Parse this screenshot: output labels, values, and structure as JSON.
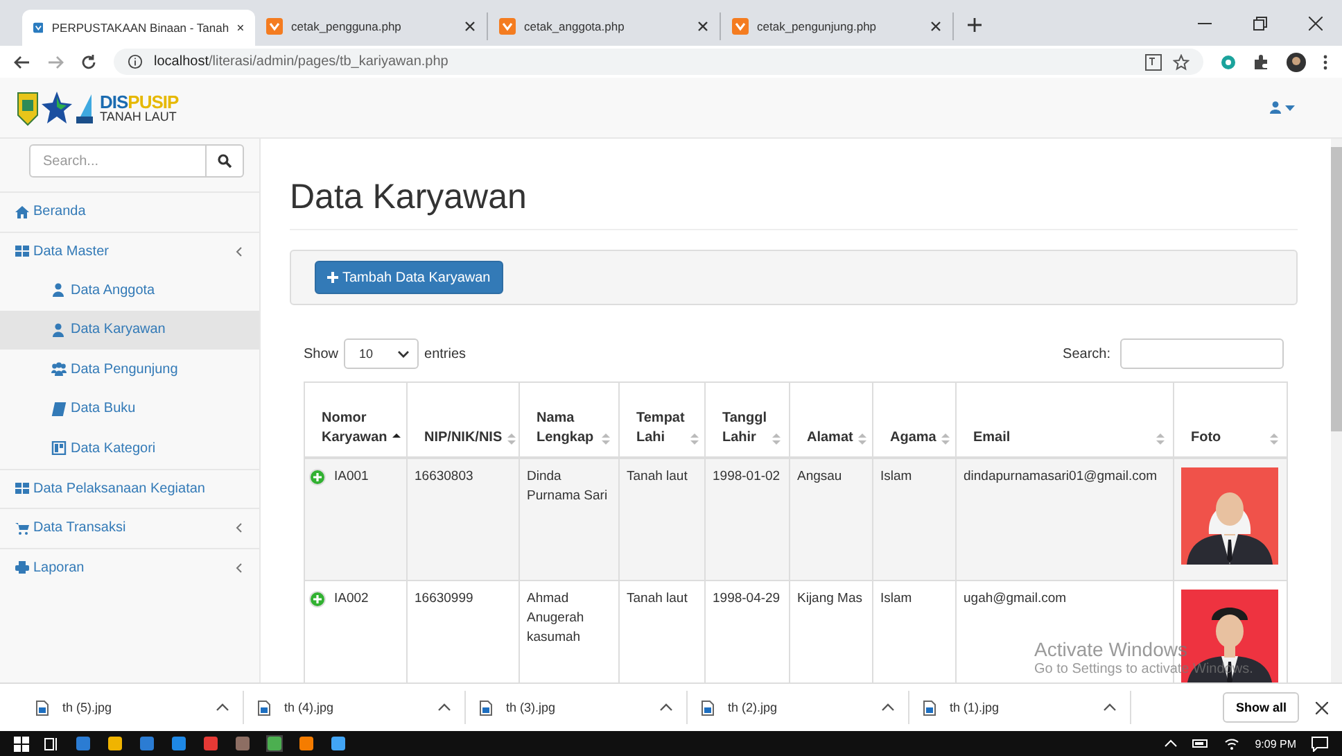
{
  "browser": {
    "tabs": [
      {
        "title": "PERPUSTAKAAN Binaan - Tanah",
        "selected": true
      },
      {
        "title": "cetak_pengguna.php",
        "selected": false
      },
      {
        "title": "cetak_anggota.php",
        "selected": false
      },
      {
        "title": "cetak_pengunjung.php",
        "selected": false
      }
    ],
    "url_host": "localhost",
    "url_path": "/literasi/admin/pages/tb_kariyawan.php"
  },
  "brand": {
    "line1_a": "DIS",
    "line1_b": "PUSIP",
    "line2": "TANAH LAUT"
  },
  "sidebar": {
    "search_placeholder": "Search...",
    "items": [
      {
        "label": "Beranda",
        "selected": false,
        "collapsible": false
      },
      {
        "label": "Data Master",
        "selected": false,
        "collapsible": true,
        "children": [
          {
            "label": "Data Anggota",
            "selected": false
          },
          {
            "label": "Data Karyawan",
            "selected": true
          },
          {
            "label": "Data Pengunjung",
            "selected": false
          },
          {
            "label": "Data Buku",
            "selected": false
          },
          {
            "label": "Data Kategori",
            "selected": false
          }
        ]
      },
      {
        "label": "Data Pelaksanaan Kegiatan",
        "selected": false,
        "collapsible": false
      },
      {
        "label": "Data Transaksi",
        "selected": false,
        "collapsible": true
      },
      {
        "label": "Laporan",
        "selected": false,
        "collapsible": true
      }
    ]
  },
  "content": {
    "title": "Data Karyawan",
    "add_button": "Tambah Data Karyawan",
    "show_label": "Show",
    "page_length": "10",
    "entries_label": "entries",
    "search_label": "Search:",
    "table": {
      "columns": [
        {
          "label": "Nomor Karyawan",
          "sorted": true
        },
        {
          "label": "NIP/NIK/NIS",
          "sorted": false
        },
        {
          "label": "Nama Lengkap",
          "sorted": false
        },
        {
          "label": "Tempat Lahi",
          "sorted": false
        },
        {
          "label": "Tanggl Lahir",
          "sorted": false
        },
        {
          "label": "Alamat",
          "sorted": false
        },
        {
          "label": "Agama",
          "sorted": false
        },
        {
          "label": "Email",
          "sorted": false
        },
        {
          "label": "Foto",
          "sorted": false
        }
      ],
      "rows": [
        {
          "cells": [
            "IA001",
            "16630803",
            "Dinda Purnama Sari",
            "Tanah laut",
            "1998-01-02",
            "Angsau",
            "Islam",
            "dindapurnamasari01@gmail.com"
          ],
          "photo": {
            "kind": "picture"
          }
        },
        {
          "cells": [
            "IA002",
            "16630999",
            "Ahmad Anugerah kasumah",
            "Tanah laut",
            "1998-04-29",
            "Kijang Mas",
            "Islam",
            "ugah@gmail.com"
          ],
          "photo": {
            "kind": "picture"
          }
        }
      ]
    }
  },
  "watermark_overlay": {
    "line1": "Activate Windows",
    "line2": "Go to Settings to activate Windows."
  },
  "downloads": {
    "files": [
      "th (5).jpg",
      "th (4).jpg",
      "th (3).jpg",
      "th (2).jpg",
      "th (1).jpg"
    ],
    "show_all": "Show all"
  },
  "taskbar": {
    "time": "9:09 PM"
  }
}
